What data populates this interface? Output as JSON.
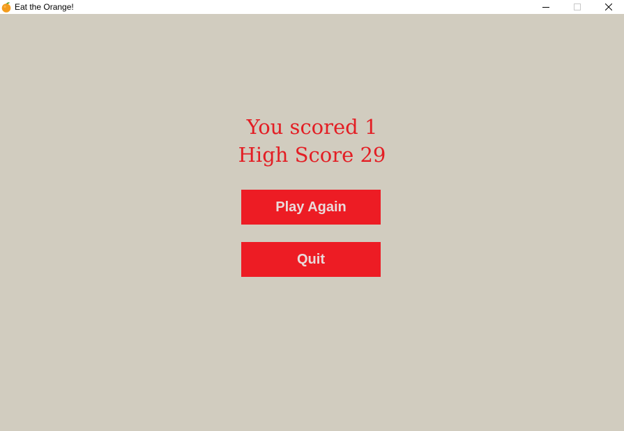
{
  "window": {
    "title": "Eat the Orange!",
    "icon": "orange-icon",
    "controls": [
      "minimize-icon",
      "maximize-icon",
      "close-icon"
    ]
  },
  "game_over": {
    "score_text": "You scored 1",
    "high_score_text": "High Score 29"
  },
  "buttons": {
    "play_again": "Play Again",
    "quit": "Quit"
  },
  "colors": {
    "background": "#d1ccbf",
    "text_red": "#e31e24",
    "button_red": "#ed1c24",
    "button_text": "#e9dada"
  }
}
